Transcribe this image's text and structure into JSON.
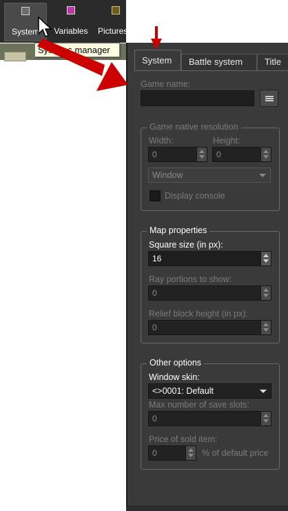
{
  "toolbar": {
    "items": [
      {
        "label": "System",
        "icon": "systems-manager-icon",
        "active": true
      },
      {
        "label": "Variables",
        "icon": "variables-icon",
        "active": false
      },
      {
        "label": "Pictures",
        "icon": "pictures-icon",
        "active": false
      }
    ],
    "tooltip": "Systems manager"
  },
  "tabs": [
    {
      "label": "System",
      "active": true
    },
    {
      "label": "Battle system",
      "active": false
    },
    {
      "label": "Title",
      "active": false
    }
  ],
  "game_name": {
    "label": "Game name:",
    "value": ""
  },
  "resolution": {
    "title": "Game native resolution",
    "width_label": "Width:",
    "width_value": "0",
    "height_label": "Height:",
    "height_value": "0",
    "mode": "Window",
    "display_console_label": "Display console"
  },
  "map_properties": {
    "title": "Map properties",
    "square_size_label": "Square size (in px):",
    "square_size_value": "16",
    "ray_portions_label": "Ray portions to show:",
    "ray_portions_value": "0",
    "relief_label": "Relief block height (in px):",
    "relief_value": "0"
  },
  "other_options": {
    "title": "Other options",
    "window_skin_label": "Window skin:",
    "window_skin_value": "<>0001: Default",
    "save_slots_label": "Max number of save slots:",
    "save_slots_value": "0",
    "price_label": "Price of sold item:",
    "price_value": "0",
    "price_suffix": "% of default price"
  },
  "colors": {
    "panel_bg": "#3a3a3a",
    "annotation_arrow": "#cc0000",
    "tooltip_bg": "#ffffe1"
  }
}
